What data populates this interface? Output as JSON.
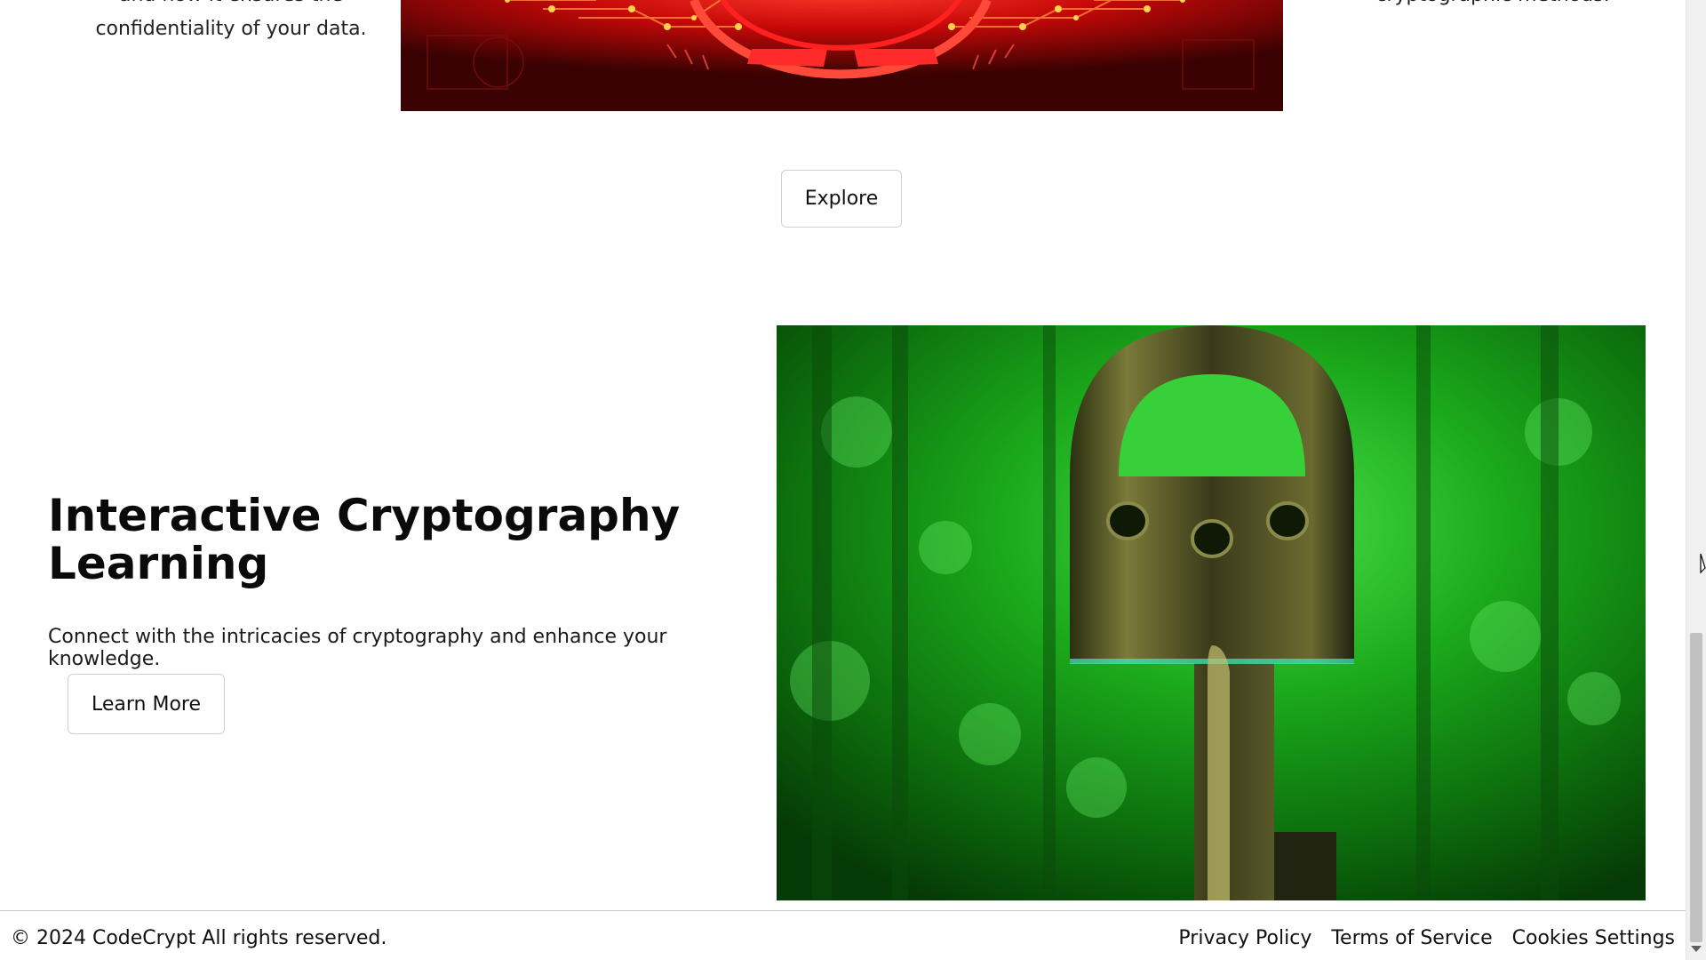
{
  "top_section": {
    "left_text_line1": "and how it ensures the",
    "left_text_line2": "confidentiality of your data.",
    "right_text_line1": "cryptographic methods."
  },
  "explore_button": {
    "label": "Explore"
  },
  "feature": {
    "title": "Interactive Cryptography Learning",
    "description": "Connect with the intricacies of cryptography and enhance your knowledge.",
    "button_label": "Learn More",
    "image_icon": "key-image"
  },
  "footer": {
    "copyright": "© 2024 CodeCrypt All rights reserved.",
    "links": [
      "Privacy Policy",
      "Terms of Service",
      "Cookies Settings"
    ]
  },
  "colors": {
    "accent_red": "#c00000",
    "accent_green": "#1fbf1f",
    "button_border": "#cfcfcf"
  }
}
